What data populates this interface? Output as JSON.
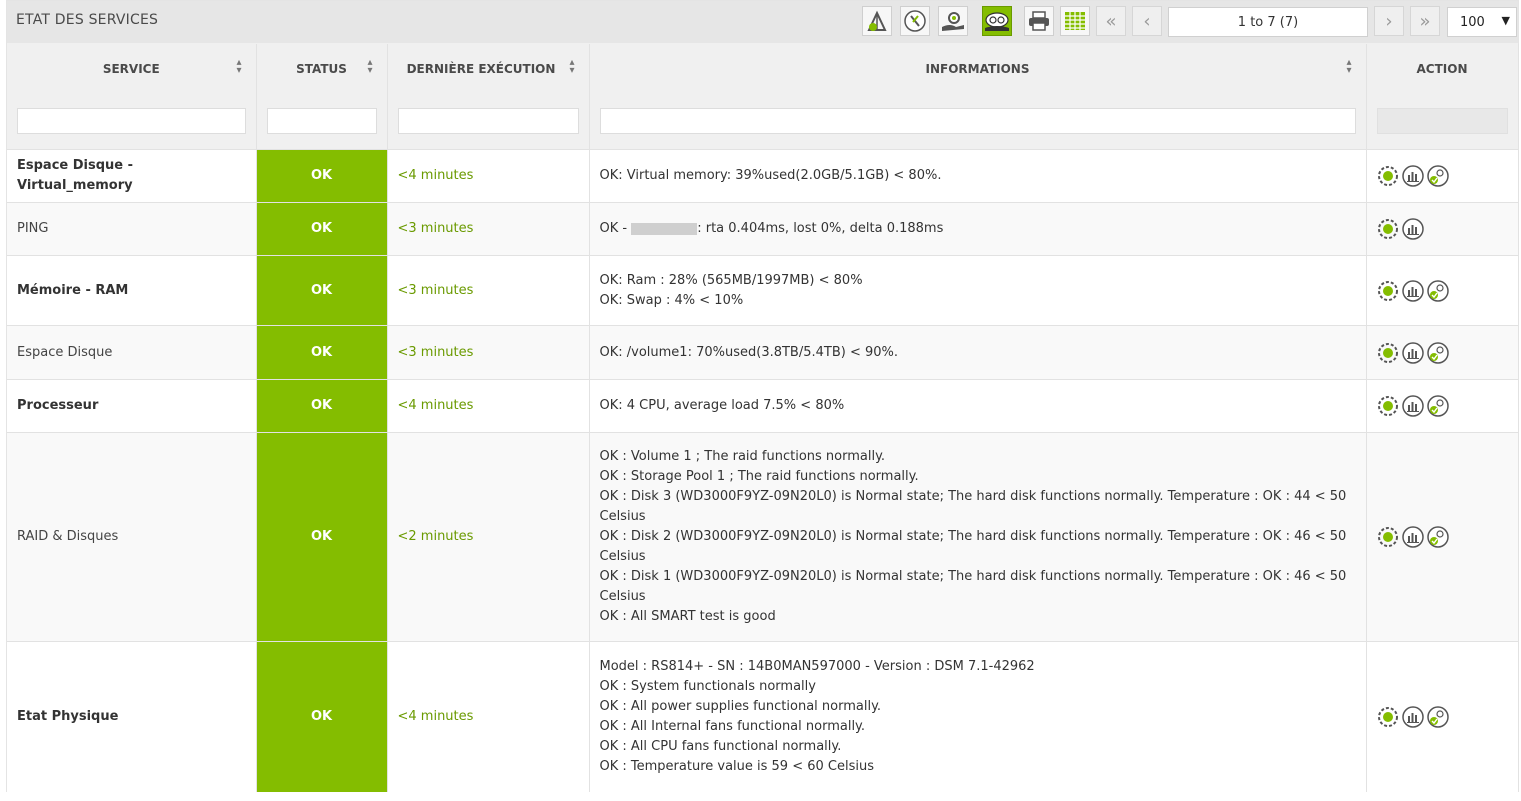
{
  "header": {
    "title": "ETAT DES SERVICES",
    "pager": "1 to 7 (7)",
    "per_page": "100",
    "toolbar_icons": [
      "monitoring-check-icon",
      "tools-icon",
      "hand-gear-icon",
      "services-cloud-icon",
      "print-icon",
      "grid-columns-icon"
    ]
  },
  "columns": {
    "service": "SERVICE",
    "status": "STATUS",
    "last_exec": "DERNIÈRE EXÉCUTION",
    "informations": "INFORMATIONS",
    "action": "ACTION"
  },
  "rows": [
    {
      "service": "Espace Disque - Virtual_memory",
      "status": "OK",
      "last_exec": "<4 minutes",
      "info": [
        "OK: Virtual memory: 39%used(2.0GB/5.1GB) < 80%."
      ],
      "actions": [
        "settings-gear-icon",
        "graph-icon",
        "acknowledge-icon"
      ]
    },
    {
      "service": "PING",
      "status": "OK",
      "last_exec": "<3 minutes",
      "info_before": "OK - ",
      "info_after": ": rta 0.404ms, lost 0%, delta 0.188ms",
      "actions": [
        "settings-gear-icon",
        "graph-icon"
      ]
    },
    {
      "service": "Mémoire - RAM",
      "status": "OK",
      "last_exec": "<3 minutes",
      "info": [
        "OK: Ram : 28% (565MB/1997MB) < 80%",
        "OK: Swap : 4% < 10%"
      ],
      "actions": [
        "settings-gear-icon",
        "graph-icon",
        "acknowledge-icon"
      ]
    },
    {
      "service": "Espace Disque",
      "status": "OK",
      "last_exec": "<3 minutes",
      "info": [
        "OK: /volume1: 70%used(3.8TB/5.4TB) < 90%."
      ],
      "actions": [
        "settings-gear-icon",
        "graph-icon",
        "acknowledge-icon"
      ]
    },
    {
      "service": "Processeur",
      "status": "OK",
      "last_exec": "<4 minutes",
      "info": [
        "OK: 4 CPU, average load 7.5% < 80%"
      ],
      "actions": [
        "settings-gear-icon",
        "graph-icon",
        "acknowledge-icon"
      ]
    },
    {
      "service": "RAID & Disques",
      "status": "OK",
      "last_exec": "<2 minutes",
      "info": [
        "OK : Volume 1 ; The raid functions normally.",
        "OK : Storage Pool 1 ; The raid functions normally.",
        "OK : Disk 3 (WD3000F9YZ-09N20L0) is Normal state; The hard disk functions normally. Temperature : OK : 44 < 50 Celsius",
        "OK : Disk 2 (WD3000F9YZ-09N20L0) is Normal state; The hard disk functions normally. Temperature : OK : 46 < 50 Celsius",
        "OK : Disk 1 (WD3000F9YZ-09N20L0) is Normal state; The hard disk functions normally. Temperature : OK : 46 < 50 Celsius",
        "OK : All SMART test is good"
      ],
      "actions": [
        "settings-gear-icon",
        "graph-icon",
        "acknowledge-icon"
      ]
    },
    {
      "service": "Etat Physique",
      "status": "OK",
      "last_exec": "<4 minutes",
      "info": [
        "Model : RS814+ - SN : 14B0MAN597000 - Version : DSM 7.1-42962",
        "OK : System functionals normally",
        "OK : All power supplies functional normally.",
        "OK : All Internal fans functional normally.",
        "OK : All CPU fans functional normally.",
        "OK : Temperature value is 59 < 60 Celsius"
      ],
      "actions": [
        "settings-gear-icon",
        "graph-icon",
        "acknowledge-icon"
      ]
    }
  ],
  "colors": {
    "ok_green": "#84bd00",
    "exec_text": "#6a9a00",
    "header_bg": "#e6e6e6"
  }
}
